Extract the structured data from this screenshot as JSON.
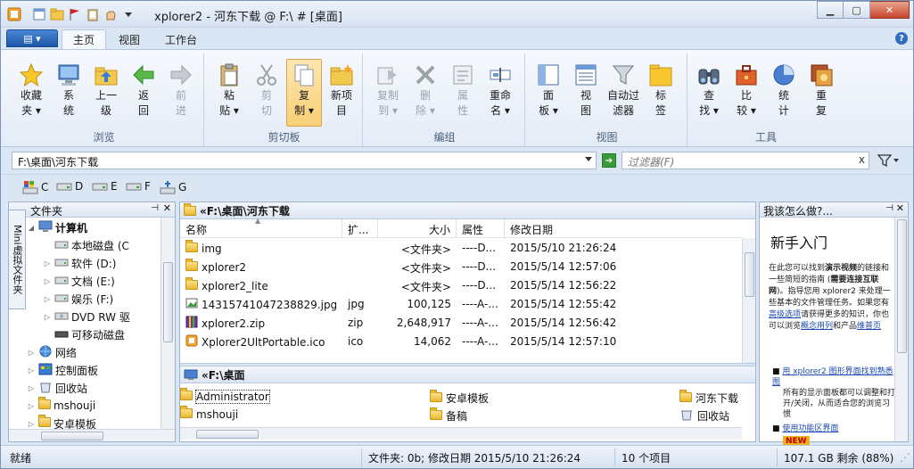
{
  "window": {
    "title": "xplorer2 - 河东下载 @ F:\\ # [桌面]"
  },
  "tabs": {
    "file_label": "▤ ▾",
    "items": [
      "主页",
      "视图",
      "工作台"
    ]
  },
  "ribbon": {
    "groups": [
      "浏览",
      "剪切板",
      "编组",
      "视图",
      "工具"
    ],
    "buttons": {
      "favorites": "收藏\n夹 ▾",
      "system": "系\n统",
      "up": "上一\n级",
      "back": "返\n回",
      "forward": "前\n进",
      "paste": "粘\n贴 ▾",
      "cut": "剪\n切",
      "copy": "复\n制 ▾",
      "newitem": "新项\n目",
      "copyto": "复制\n到 ▾",
      "delete": "删\n除 ▾",
      "props": "属\n性",
      "rename": "重命\n名 ▾",
      "panel": "面\n板 ▾",
      "view": "视\n图",
      "autofilter": "自动过\n滤器",
      "bookmark": "标\n签",
      "find": "查\n找 ▾",
      "compare": "比\n较 ▾",
      "stats": "统\n计",
      "dupes": "重\n复"
    }
  },
  "address": {
    "path": "F:\\桌面\\河东下载",
    "filter_placeholder": "过滤器(F)",
    "filter_clear": "x"
  },
  "drives": [
    "C",
    "D",
    "E",
    "F",
    "G"
  ],
  "folders_pane": {
    "title": "文件夹",
    "side_tab": "Mini虚拟文件夹",
    "tree": [
      {
        "label": "计算机",
        "bold": true,
        "toggle": "◢"
      },
      {
        "label": "本地磁盘 (C",
        "toggle": ""
      },
      {
        "label": "软件 (D:)",
        "toggle": "▷"
      },
      {
        "label": "文档 (E:)",
        "toggle": "▷"
      },
      {
        "label": "娱乐 (F:)",
        "toggle": "▷"
      },
      {
        "label": "DVD RW 驱",
        "toggle": "▷"
      },
      {
        "label": "可移动磁盘",
        "toggle": ""
      },
      {
        "label": "网络",
        "toggle": "▷"
      },
      {
        "label": "控制面板",
        "toggle": "▷"
      },
      {
        "label": "回收站",
        "toggle": "▷"
      },
      {
        "label": "mshouji",
        "toggle": "▷"
      },
      {
        "label": "安卓模板",
        "toggle": "▷"
      }
    ]
  },
  "main_pane": {
    "path": "«F:\\桌面\\河东下载",
    "columns": [
      "名称",
      "扩...",
      "大小",
      "属性",
      "修改日期"
    ],
    "rows": [
      {
        "name": "img",
        "ext": "",
        "size": "<文件夹>",
        "attr": "----D...",
        "date": "2015/5/10 21:26:24",
        "kind": "folder"
      },
      {
        "name": "xplorer2",
        "ext": "",
        "size": "<文件夹>",
        "attr": "----D...",
        "date": "2015/5/14 12:57:06",
        "kind": "folder"
      },
      {
        "name": "xplorer2_lite",
        "ext": "",
        "size": "<文件夹>",
        "attr": "----D...",
        "date": "2015/5/14 12:56:22",
        "kind": "folder"
      },
      {
        "name": "14315741047238829.jpg",
        "ext": "jpg",
        "size": "100,125",
        "attr": "----A-...",
        "date": "2015/5/14 12:55:42",
        "kind": "image"
      },
      {
        "name": "xplorer2.zip",
        "ext": "zip",
        "size": "2,648,917",
        "attr": "----A-...",
        "date": "2015/5/14 12:56:42",
        "kind": "zip"
      },
      {
        "name": "Xplorer2UltPortable.ico",
        "ext": "ico",
        "size": "14,062",
        "attr": "----A-...",
        "date": "2015/5/14 12:57:10",
        "kind": "ico"
      }
    ]
  },
  "lower_pane": {
    "path": "«F:\\桌面",
    "items": [
      {
        "label": "Administrator",
        "kind": "folder"
      },
      {
        "label": "安卓模板",
        "kind": "folder"
      },
      {
        "label": "河东下载",
        "kind": "folder"
      },
      {
        "label": "mshouji",
        "kind": "folder"
      },
      {
        "label": "备稿",
        "kind": "folder"
      },
      {
        "label": "回收站",
        "kind": "bin"
      }
    ]
  },
  "help_pane": {
    "title": "我该怎么做?...",
    "heading": "新手入门",
    "para_pre": "在此您可以找到",
    "para_bold1": "演示视频",
    "para_mid1": "的链接和一些简短的指南 (",
    "para_bold2": "需要连接互联网",
    "para_mid2": ")。指导您用 xplorer2 来处理一些基本的文件管理任务。如果您有",
    "para_link1": "高级选项",
    "para_mid3": "请获得更多的知识，你也可以浏览",
    "para_link2": "概念用列",
    "para_end": "和产品",
    "para_link3": "维普页",
    "bullet1_link": "用 xplorer2 图形界面找到熟悉图",
    "bullet1_text": "所有的显示面板都可以调整和打开/关闭，从而适合您的浏览习惯",
    "bullet2_link": "使用功能区界面",
    "bullet2_badge": "NEW"
  },
  "status": {
    "ready": "就绪",
    "info": "文件夹: 0b; 修改日期 2015/5/10 21:26:24",
    "count": "10 个项目",
    "space": "107.1 GB 剩余 (88%)"
  }
}
